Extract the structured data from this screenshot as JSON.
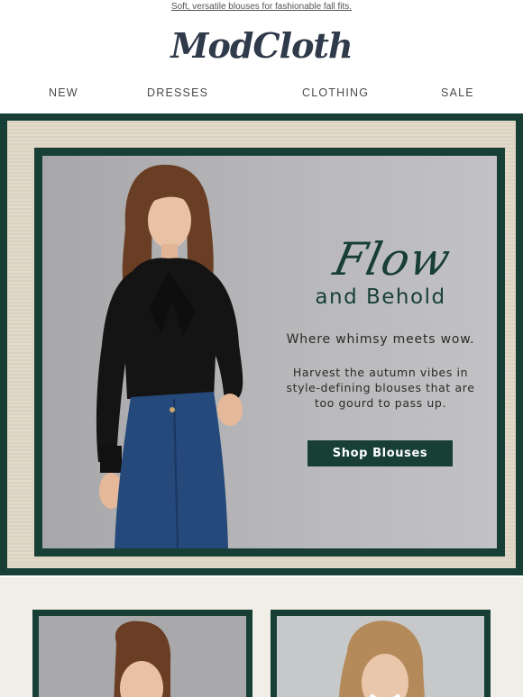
{
  "preheader": "Soft, versatile blouses for fashionable fall fits.",
  "brand": {
    "logo_text": "ModCloth"
  },
  "nav": {
    "items": [
      "NEW",
      "DRESSES",
      "CLOTHING",
      "SALE"
    ]
  },
  "hero": {
    "headline_script": "Flow",
    "headline_sub": "and Behold",
    "tagline": "Where whimsy meets wow.",
    "body": "Harvest the autumn vibes in style-defining blouses that are too gourd to pass up.",
    "cta_label": "Shop Blouses"
  },
  "colors": {
    "brand_green": "#173f36",
    "paper": "#e0d6c6",
    "hero_bg": "#b8b8ba"
  },
  "products": [
    {
      "image": "model-with-bangs-photo"
    },
    {
      "image": "smiling-blonde-model-photo"
    }
  ]
}
